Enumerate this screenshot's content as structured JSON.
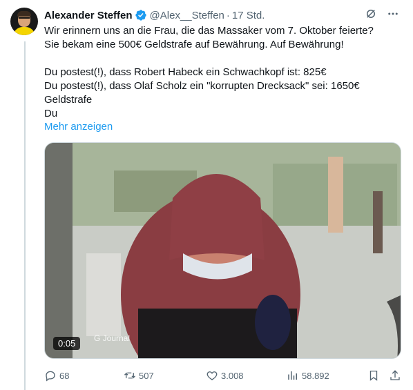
{
  "tweet": {
    "author_name": "Alexander Steffen",
    "handle": "@Alex__Steffen",
    "separator": "·",
    "time": "17 Std.",
    "lines": [
      "Wir erinnern uns an die Frau, die das Massaker vom 7. Oktober feierte?",
      "Sie bekam eine 500€ Geldstrafe auf Bewährung. Auf Bewährung!",
      "",
      "Du postest(!), dass Robert Habeck ein Schwachkopf ist: 825€",
      "Du postest(!), dass Olaf Scholz ein \"korrupten Drecksack\" sei: 1650€",
      "Geldstrafe",
      "Du"
    ],
    "show_more": "Mehr anzeigen"
  },
  "media": {
    "duration": "0:05",
    "watermark": "G Journal"
  },
  "actions": {
    "replies": "68",
    "reposts": "507",
    "likes": "3.008",
    "views": "58.892"
  },
  "colors": {
    "accent": "#1d9bf0",
    "verified": "#1d9bf0",
    "muted": "#536471"
  },
  "icons": [
    "verified-badge-icon",
    "grok-icon",
    "more-icon",
    "reply-icon",
    "repost-icon",
    "like-icon",
    "views-icon",
    "bookmark-icon",
    "share-icon"
  ]
}
